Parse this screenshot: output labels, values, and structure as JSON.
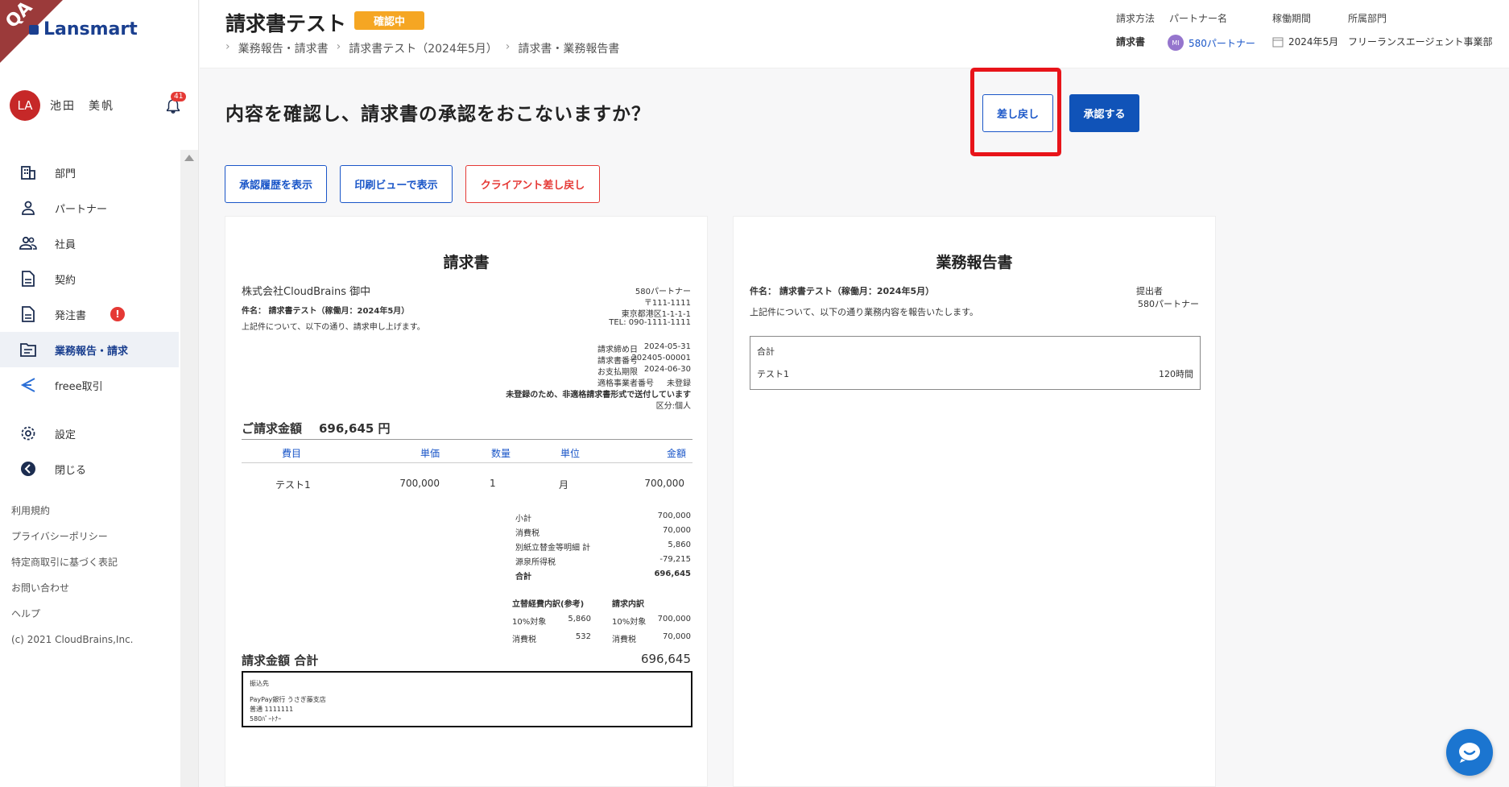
{
  "brand": {
    "name": "Lansmart",
    "qa": "QA"
  },
  "user": {
    "initials": "LA",
    "name": "池田　美帆",
    "notifications": "41"
  },
  "nav": [
    {
      "label": "部門",
      "icon": "building-icon"
    },
    {
      "label": "パートナー",
      "icon": "person-icon"
    },
    {
      "label": "社員",
      "icon": "people-icon"
    },
    {
      "label": "契約",
      "icon": "document-icon"
    },
    {
      "label": "発注書",
      "icon": "document-icon",
      "badge": "!"
    },
    {
      "label": "業務報告・請求",
      "icon": "folder-icon",
      "active": true
    },
    {
      "label": "freee取引",
      "icon": "freee-icon"
    }
  ],
  "nav2": [
    {
      "label": "設定",
      "icon": "gear-icon"
    },
    {
      "label": "閉じる",
      "icon": "back-arrow-icon"
    }
  ],
  "footer": [
    "利用規約",
    "プライバシーポリシー",
    "特定商取引に基づく表記",
    "お問い合わせ",
    "ヘルプ",
    "(c) 2021 CloudBrains,Inc."
  ],
  "header": {
    "title": "請求書テスト",
    "status": "確認中",
    "breadcrumb": [
      "業務報告・請求書",
      "請求書テスト（2024年5月）",
      "請求書・業務報告書"
    ],
    "meta": {
      "method_label": "請求方法",
      "method": "請求書",
      "partner_label": "パートナー名",
      "partner_initials": "MI",
      "partner": "580パートナー",
      "period_label": "稼働期間",
      "period": "2024年5月",
      "dept_label": "所属部門",
      "dept": "フリーランスエージェント事業部"
    }
  },
  "main": {
    "question": "内容を確認し、請求書の承認をおこないますか？",
    "reject_label": "差し戻し",
    "approve_label": "承認する",
    "history_label": "承認履歴を表示",
    "print_label": "印刷ビューで表示",
    "client_reject_label": "クライアント差し戻し"
  },
  "invoice": {
    "title": "請求書",
    "to": "株式会社CloudBrains 御中",
    "subject": "件名： 請求書テスト（稼働月：2024年5月）",
    "intro": "上記件について、以下の通り、請求申し上げます。",
    "issuer": [
      "580パートナー",
      "〒111-1111",
      "東京都港区1-1-1-1",
      "TEL: 090-1111-1111"
    ],
    "info": [
      [
        "請求締め日",
        "2024-05-31"
      ],
      [
        "請求書番号",
        "202405-00001"
      ],
      [
        "お支払期限",
        "2024-06-30"
      ],
      [
        "適格事業者番号",
        "未登録"
      ]
    ],
    "notice": "未登録のため、非適格請求書形式で送付しています",
    "category": "区分:個人",
    "amount_label": "ご請求金額",
    "amount": "696,645 円",
    "columns": [
      "費目",
      "単価",
      "数量",
      "単位",
      "金額"
    ],
    "row": [
      "テスト1",
      "700,000",
      "1",
      "月",
      "700,000"
    ],
    "summary": [
      [
        "小計",
        "700,000"
      ],
      [
        "消費税",
        "70,000"
      ],
      [
        "別紙立替金等明細 計",
        "5,860"
      ],
      [
        "源泉所得税",
        "-79,215"
      ],
      [
        "合計",
        "696,645"
      ]
    ],
    "breakdown_heads": [
      "立替経費内訳(参考)",
      "請求内訳"
    ],
    "breakdown": [
      [
        "10%対象",
        "5,860",
        "10%対象",
        "700,000"
      ],
      [
        "消費税",
        "532",
        "消費税",
        "70,000"
      ]
    ],
    "total_label": "請求金額 合計",
    "total": "696,645",
    "bank": [
      "振込先",
      "PayPay銀行 うさぎ藤支店",
      "普通 1111111",
      "580ﾊﾟｰﾄﾅｰ"
    ]
  },
  "report": {
    "title": "業務報告書",
    "subject": "件名： 請求書テスト（稼働月：2024年5月）",
    "intro": "上記件について、以下の通り業務内容を報告いたします。",
    "submitter_label": "提出者",
    "submitter": "580パートナー",
    "table_head": "合計",
    "item": "テスト1",
    "hours": "120時間"
  },
  "colors": {
    "accent": "#1053b8",
    "danger": "#e53935",
    "status": "#f5a623",
    "highlight": "#e8141a"
  }
}
